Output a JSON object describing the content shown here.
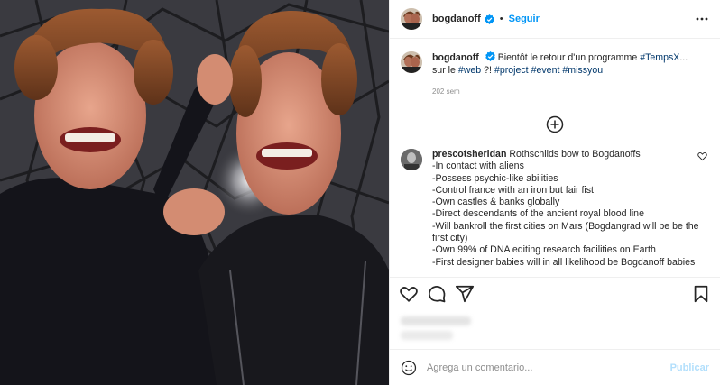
{
  "header": {
    "username": "bogdanoff",
    "separator": "•",
    "follow_label": "Seguir"
  },
  "caption": {
    "username": "bogdanoff",
    "text_before": "Bientôt le retour d'un programme",
    "tag1": "#TempsX",
    "text_mid": "... sur le",
    "tag2": "#web",
    "text_after": "?!",
    "tag3": "#project",
    "tag4": "#event",
    "tag5": "#missyou",
    "age": "202 sem"
  },
  "comment": {
    "username": "prescotsheridan",
    "intro": "Rothschilds bow to Bogdanoffs",
    "lines": [
      "-In contact with aliens",
      "-Possess psychic-like abilities",
      "-Control france with an iron but fair fist",
      "-Own castles & banks globally",
      "-Direct descendants of the ancient royal blood line",
      "-Will bankroll the first cities on Mars (Bogdangrad will be be the first city)",
      "-Own 99% of DNA editing research facilities on Earth",
      "-First designer babies will in all likelihood be Bogdanoff babies"
    ]
  },
  "composer": {
    "placeholder": "Agrega un comentario...",
    "publish_label": "Publicar"
  },
  "colors": {
    "link": "#00376b",
    "follow": "#0095f6",
    "publish_disabled": "#b2dffc",
    "border": "#efefef"
  }
}
